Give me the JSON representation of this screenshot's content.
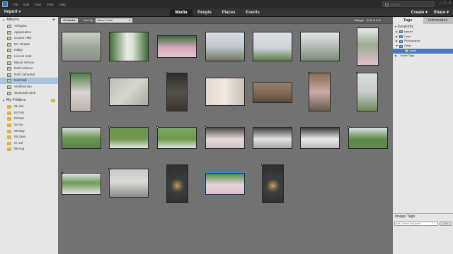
{
  "app": {
    "menus": [
      "File",
      "Edit",
      "Find",
      "View",
      "Help"
    ],
    "search_placeholder": "Search"
  },
  "toolbar": {
    "import_label": "Import",
    "views": [
      "Media",
      "People",
      "Places",
      "Events"
    ],
    "create_label": "Create",
    "share_label": "Share"
  },
  "left_panel": {
    "albums_header": "Albums",
    "albums": [
      "Arlington",
      "Appamattox",
      "Coxom Hike",
      "DC Temple",
      "Inttipy",
      "Lincoln Vont",
      "Mount Vernon",
      "Natl Archives",
      "Natl Cathedral",
      "Natl Mall",
      "Smithsonian",
      "Stonewall Jack"
    ],
    "selected_album": "Natl Mall",
    "folders_header": "My Folders",
    "folders": [
      "01 Jan",
      "02 Feb",
      "03 Mar",
      "04 Apr",
      "05 May",
      "06 June",
      "07 Jul",
      "08 Aug"
    ]
  },
  "media_bar": {
    "all_media": "All Media",
    "sort_by_label": "Sort By:",
    "sort_value": "Album Order",
    "ratings_label": "Ratings",
    "ratings_stars": "★★★★★"
  },
  "right_panel": {
    "tabs": [
      "Tags",
      "Information"
    ],
    "active_tab": "Tags",
    "keywords_header": "Keywords",
    "keywords": [
      "Nature",
      "Color",
      "Photography",
      "Other"
    ],
    "other_child": "party",
    "smart_tags": "Smart Tags",
    "image_tags_header": "Image Tags",
    "keyword_placeholder": "Add Custom Keywords",
    "add_label": "Add"
  },
  "colors": {
    "grid_bg": "#727272",
    "selection": "#3d8bdc"
  },
  "grid": {
    "thumbnails": [
      {
        "scene": "trees-washed",
        "badge": false
      },
      {
        "scene": "statue-trees",
        "badge": false
      },
      {
        "scene": "group-girls-white",
        "badge": false
      },
      {
        "scene": "fountain-plaza",
        "badge": false
      },
      {
        "scene": "monument-cloudy",
        "badge": false
      },
      {
        "scene": "fountain-pillars",
        "badge": false
      },
      {
        "scene": "kids-portrait",
        "badge": false
      },
      {
        "scene": "girls-portrait",
        "badge": true
      },
      {
        "scene": "stone-inscription",
        "badge": true
      },
      {
        "scene": "dark-plaque",
        "badge": true
      },
      {
        "scene": "selfie-girl",
        "badge": false
      },
      {
        "scene": "brown-room",
        "badge": false
      },
      {
        "scene": "tall-brown",
        "badge": true
      },
      {
        "scene": "boy-monument",
        "badge": true
      },
      {
        "scene": "wide-park",
        "badge": false
      },
      {
        "scene": "kid-lawn",
        "badge": true
      },
      {
        "scene": "girl-lawn",
        "badge": true
      },
      {
        "scene": "two-girls-fountain",
        "badge": true
      },
      {
        "scene": "two-girls-dark",
        "badge": false
      },
      {
        "scene": "three-kids",
        "badge": false
      },
      {
        "scene": "garden-people",
        "badge": true
      },
      {
        "scene": "kids-garden-blossom",
        "badge": true
      },
      {
        "scene": "memorial-pillar",
        "badge": true
      },
      {
        "scene": "lamp-night",
        "badge": false
      },
      {
        "scene": "girls-fountain-selected",
        "badge": false
      },
      {
        "scene": "lamp-night-2",
        "badge": true
      }
    ]
  }
}
